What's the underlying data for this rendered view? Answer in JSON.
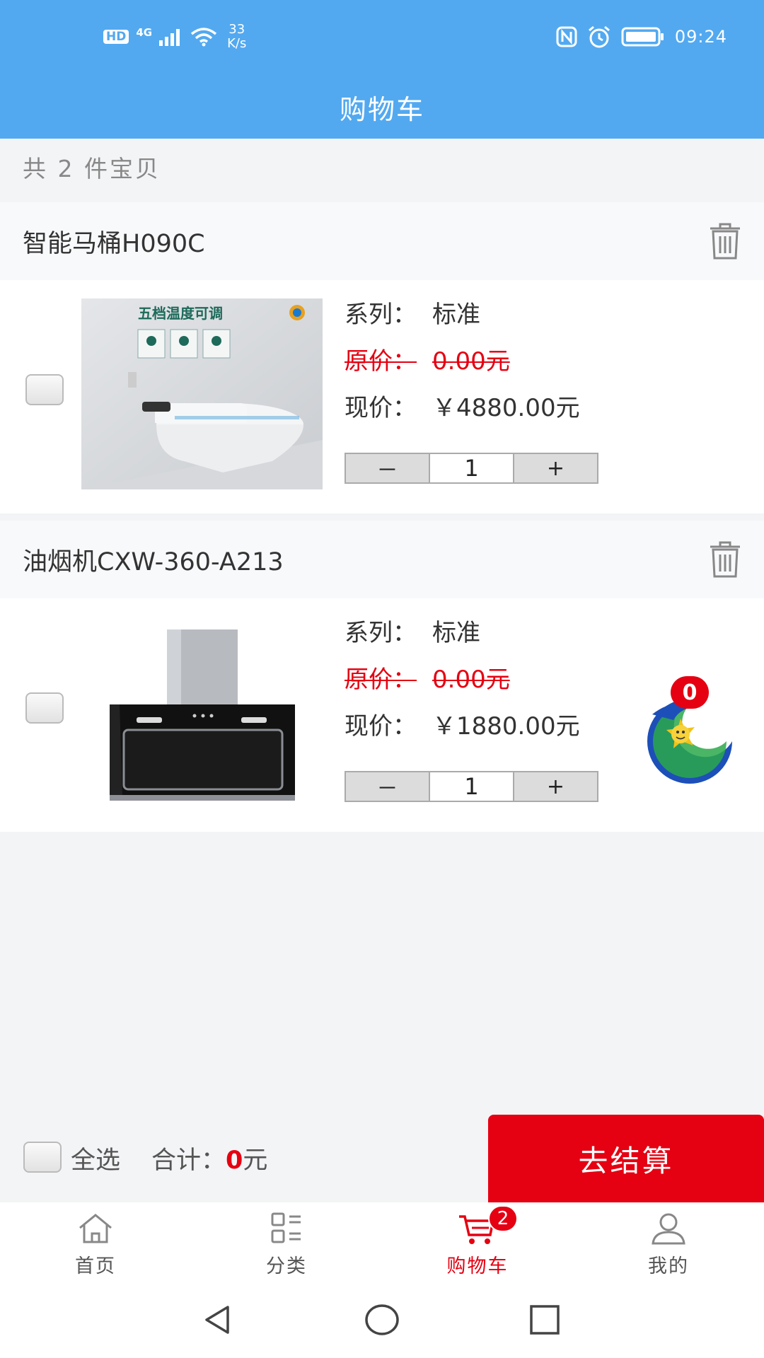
{
  "status_bar": {
    "hd": "HD",
    "signal": "4G",
    "speed_value": "33",
    "speed_unit": "K/s",
    "time": "09:24"
  },
  "header": {
    "title": "购物车"
  },
  "summary": {
    "count_text": "共 2 件宝贝"
  },
  "items": [
    {
      "name": "智能马桶H090C",
      "image_caption": "五档温度可调",
      "series_label": "系列：",
      "series_value": "标准",
      "original_label": "原价：",
      "original_price": "0.00元",
      "current_label": "现价：",
      "current_price": "￥4880.00元",
      "minus": "－",
      "quantity": "1",
      "plus": "+"
    },
    {
      "name": "油烟机CXW-360-A213",
      "series_label": "系列：",
      "series_value": "标准",
      "original_label": "原价：",
      "original_price": "0.00元",
      "current_label": "现价：",
      "current_price": "￥1880.00元",
      "minus": "－",
      "quantity": "1",
      "plus": "+"
    }
  ],
  "floating_badge": {
    "count": "0"
  },
  "checkout": {
    "select_all": "全选",
    "total_label": "合计：",
    "total_value": "0",
    "total_unit": "元",
    "button": "去结算"
  },
  "tabs": [
    {
      "label": "首页",
      "icon": "home-icon"
    },
    {
      "label": "分类",
      "icon": "category-icon"
    },
    {
      "label": "购物车",
      "icon": "cart-icon",
      "badge": "2",
      "active": true
    },
    {
      "label": "我的",
      "icon": "user-icon"
    }
  ],
  "colors": {
    "primary": "#52a9f0",
    "accent": "#e50012"
  }
}
